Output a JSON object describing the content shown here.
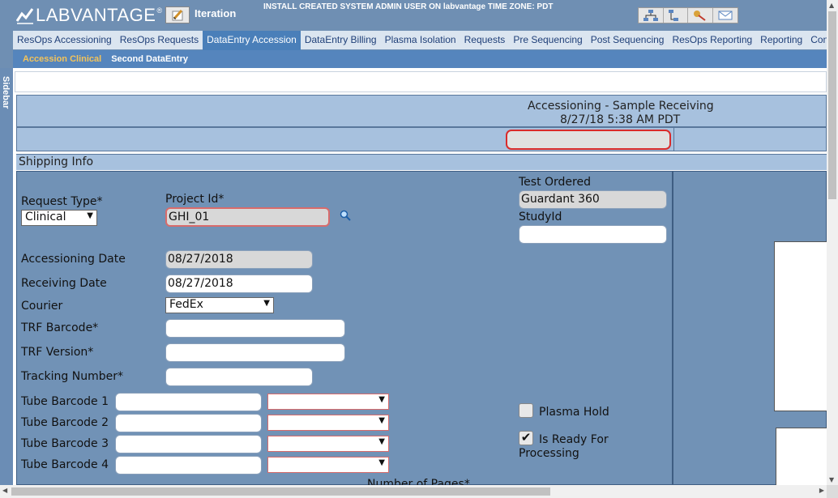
{
  "header": {
    "logo_text": "LABVANTAGE",
    "logo_reg": "®",
    "iteration_label": "Iteration",
    "system_info": "INSTALL CREATED SYSTEM ADMIN USER ON labvantage TIME ZONE: PDT",
    "icons": [
      "org-chart-icon",
      "hierarchy-icon",
      "keys-icon",
      "mail-icon"
    ]
  },
  "main_tabs": [
    {
      "label": "ResOps Accessioning"
    },
    {
      "label": "ResOps Requests"
    },
    {
      "label": "DataEntry Accession"
    },
    {
      "label": "DataEntry Billing"
    },
    {
      "label": "Plasma Isolation"
    },
    {
      "label": "Requests"
    },
    {
      "label": "Pre Sequencing"
    },
    {
      "label": "Post Sequencing"
    },
    {
      "label": "ResOps Reporting"
    },
    {
      "label": "Reporting"
    },
    {
      "label": "Controls"
    }
  ],
  "sub_tabs": [
    {
      "label": "Accession Clinical"
    },
    {
      "label": "Second DataEntry"
    }
  ],
  "sidebar": {
    "label": "Sidebar"
  },
  "page": {
    "title": "Accessioning - Sample Receiving",
    "datetime": "8/27/18 5:38 AM PDT"
  },
  "section": {
    "shipping_info": "Shipping Info"
  },
  "form": {
    "request_type_label": "Request Type*",
    "request_type_value": "Clinical",
    "project_id_label": "Project Id*",
    "project_id_value": "GHI_01",
    "test_ordered_label": "Test Ordered",
    "test_ordered_value": "Guardant 360",
    "study_id_label": "StudyId",
    "study_id_value": "",
    "accessioning_date_label": "Accessioning Date",
    "accessioning_date_value": "08/27/2018",
    "receiving_date_label": "Receiving Date",
    "receiving_date_value": "08/27/2018",
    "courier_label": "Courier",
    "courier_value": "FedEx",
    "trf_barcode_label": "TRF Barcode*",
    "trf_version_label": "TRF Version*",
    "tracking_number_label": "Tracking Number*",
    "tubes": [
      {
        "label": "Tube Barcode",
        "num": "1"
      },
      {
        "label": "Tube Barcode",
        "num": "2"
      },
      {
        "label": "Tube Barcode",
        "num": "3"
      },
      {
        "label": "Tube Barcode",
        "num": "4"
      }
    ],
    "plasma_hold_label": "Plasma Hold",
    "plasma_hold_checked": false,
    "ready_label_line1": "Is Ready For",
    "ready_label_line2": "Processing",
    "ready_checked": true,
    "ready_check_glyph": "✔",
    "pages_label": "Number of Pages*"
  },
  "colors": {
    "header": "#6f8fb3",
    "active_tab": "#4a7fb9",
    "subbar": "#5585bd",
    "active_subtab": "#f3c35a",
    "form_panel": "#7192b6",
    "title_band": "#a7c1de",
    "error_border": "#d92b2b"
  }
}
